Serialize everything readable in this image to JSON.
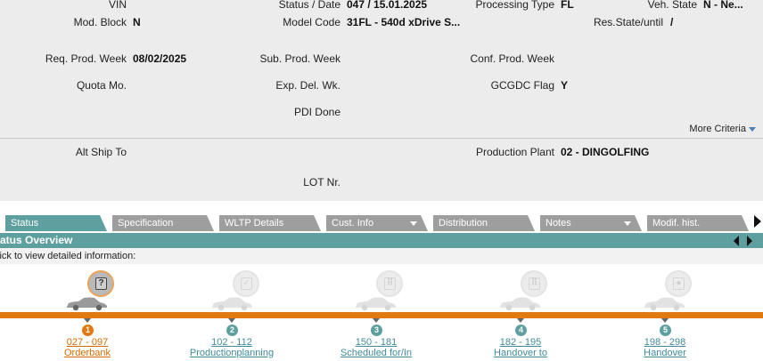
{
  "header": {
    "vin_label": "VIN",
    "mod_block_label": "Mod. Block",
    "mod_block_value": "N",
    "status_date_label": "Status / Date",
    "status_date_value": "047 /  15.01.2025",
    "model_code_label": "Model Code",
    "model_code_value": "31FL - 540d xDrive S...",
    "processing_type_label": "Processing Type",
    "processing_type_value": "FL",
    "veh_state_label": "Veh. State",
    "veh_state_value": "N - Ne...",
    "res_state_label": "Res.State/until",
    "res_state_value": "/",
    "req_prod_week_label": "Req. Prod. Week",
    "req_prod_week_value": "08/02/2025",
    "sub_prod_week_label": "Sub. Prod. Week",
    "conf_prod_week_label": "Conf. Prod. Week",
    "quota_mo_label": "Quota Mo.",
    "exp_del_wk_label": "Exp. Del. Wk.",
    "gcgdc_flag_label": "GCGDC Flag",
    "gcgdc_flag_value": "Y",
    "pdi_done_label": "PDI Done",
    "more_criteria_label": "More Criteria"
  },
  "shipping": {
    "alt_ship_to_label": "Alt Ship To",
    "production_plant_label": "Production Plant",
    "production_plant_value": "02 - DINGOLFING",
    "lot_nr_label": "LOT Nr."
  },
  "tabs": [
    {
      "label": "Status"
    },
    {
      "label": "Specification"
    },
    {
      "label": "WLTP Details"
    },
    {
      "label": "Cust. Info"
    },
    {
      "label": "Distribution"
    },
    {
      "label": "Notes"
    },
    {
      "label": "Modif. hist."
    }
  ],
  "status_overview": {
    "title": "tatus Overview",
    "hint": "lick to view detailed information:"
  },
  "steps": [
    {
      "num": "1",
      "range": "027 - 097",
      "label": "Orderbank",
      "active": true
    },
    {
      "num": "2",
      "range": "102 - 112",
      "label": "Productionplanning",
      "active": false
    },
    {
      "num": "3",
      "range": "150 - 181",
      "label": "Scheduled for/In",
      "active": false
    },
    {
      "num": "4",
      "range": "182 - 195",
      "label": "Handover to",
      "active": false
    },
    {
      "num": "5",
      "range": "198 - 298",
      "label": "Handover",
      "active": false
    }
  ],
  "colors": {
    "accent_teal": "#5e9fa0",
    "accent_orange": "#e07a10"
  }
}
